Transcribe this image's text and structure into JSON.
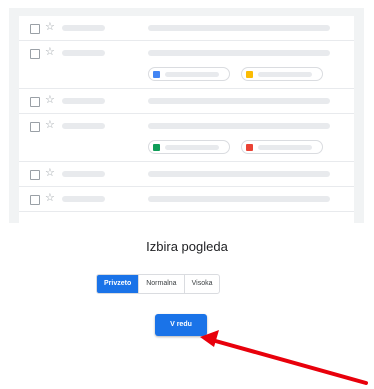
{
  "dialog": {
    "title": "Izbira pogleda",
    "density_options": [
      "Privzeto",
      "Normalna",
      "Visoka"
    ],
    "selected_option": "Privzeto",
    "ok_label": "V redu"
  },
  "colors": {
    "accent": "#1a73e8",
    "arrow": "#e8000b"
  },
  "preview": {
    "attachment_icons": [
      "docs-icon",
      "slides-icon",
      "sheets-icon",
      "image-icon"
    ]
  }
}
